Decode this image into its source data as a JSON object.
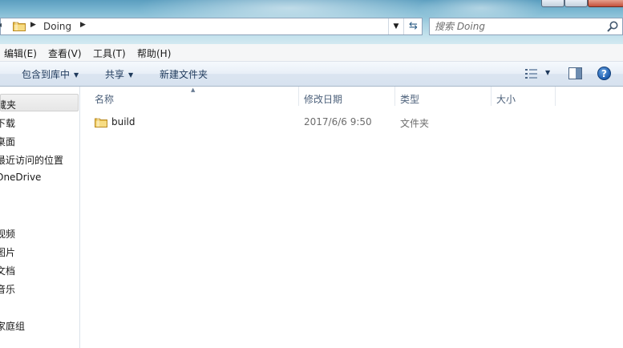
{
  "address": {
    "path_segment": "Doing"
  },
  "search": {
    "placeholder": "搜索 Doing"
  },
  "menu": {
    "items": [
      {
        "label": "编辑(E)"
      },
      {
        "label": "查看(V)"
      },
      {
        "label": "工具(T)"
      },
      {
        "label": "帮助(H)"
      }
    ]
  },
  "toolbar": {
    "include_label": "包含到库中",
    "share_label": "共享",
    "new_folder_label": "新建文件夹",
    "help_glyph": "?"
  },
  "nav": {
    "items": [
      {
        "label": "藏夹"
      },
      {
        "label": "下载"
      },
      {
        "label": "桌面"
      },
      {
        "label": "最近访问的位置"
      },
      {
        "label": "OneDrive"
      },
      {
        "label": "视频"
      },
      {
        "label": "图片"
      },
      {
        "label": "文档"
      },
      {
        "label": "音乐"
      },
      {
        "label": "家庭组"
      }
    ]
  },
  "columns": {
    "name": "名称",
    "modified": "修改日期",
    "type": "类型",
    "size": "大小"
  },
  "files": [
    {
      "name": "build",
      "modified": "2017/6/6 9:50",
      "type": "文件夹",
      "size": ""
    }
  ],
  "icons": {
    "folder": "folder-icon",
    "search": "search-icon",
    "refresh": "refresh-icon",
    "views": "views-icon",
    "preview_pane": "preview-pane-icon",
    "help": "help-icon"
  },
  "colors": {
    "folder_fill": "#f2cf6a",
    "folder_edge": "#c99a2e",
    "command_text": "#1e395b",
    "column_text": "#4c607a",
    "secondary_text": "#6d6d6d"
  }
}
